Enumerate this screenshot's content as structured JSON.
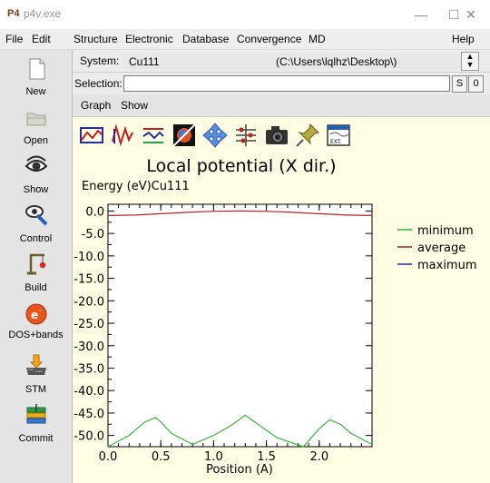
{
  "window": {
    "app_icon": "P4",
    "title": "p4v.exe",
    "buttons": {
      "minimize": "—",
      "maximize": "☐",
      "close": "✕"
    }
  },
  "menubar": {
    "items": [
      "File",
      "Edit",
      "Structure",
      "Electronic",
      "Database",
      "Convergence",
      "MD"
    ],
    "help": "Help"
  },
  "sidebar": {
    "items": [
      {
        "label": "New",
        "icon": "new-document-icon"
      },
      {
        "label": "Open",
        "icon": "open-folder-icon"
      },
      {
        "label": "Show",
        "icon": "eye-icon"
      },
      {
        "label": "Control",
        "icon": "control-wrench-icon"
      },
      {
        "label": "Build",
        "icon": "build-crane-icon"
      },
      {
        "label": "DOS+bands",
        "icon": "electron-icon"
      },
      {
        "label": "STM",
        "icon": "stm-icon"
      },
      {
        "label": "Commit",
        "icon": "commit-stack-icon"
      }
    ]
  },
  "system": {
    "label": "System:",
    "value": "Cu111",
    "path": "(C:\\Users\\lqlhz\\Desktop\\)"
  },
  "selection": {
    "label": "Selection:",
    "value": "",
    "btn_s": "S",
    "btn_0": "0"
  },
  "tabs": [
    "Graph",
    "Show"
  ],
  "toolbar": {
    "icons": [
      "chart-minmax-icon",
      "chart-wave-icon",
      "chart-avg-icon",
      "color-map-icon",
      "move-icon",
      "axes-icon",
      "camera-icon",
      "pin-icon",
      "export-icon"
    ],
    "export_label": "EXT."
  },
  "colors": {
    "minimum": "#3cb43c",
    "average": "#b02424",
    "maximum": "#2a2aa0",
    "plot_bg": "#ffffff",
    "panel_bg": "#fefce3"
  },
  "chart_data": {
    "type": "line",
    "title": "Local potential (X dir.)",
    "subtitle": "Energy (eV)Cu111",
    "xlabel": "Position (A)",
    "ylabel": "",
    "xlim": [
      0.0,
      2.5
    ],
    "ylim": [
      -52.5,
      1.5
    ],
    "xticks": [
      "0.0",
      "0.5",
      "1.0",
      "1.5",
      "2.0"
    ],
    "xtick_values": [
      0.0,
      0.5,
      1.0,
      1.5,
      2.0
    ],
    "yticks": [
      "0.0",
      "-5.0",
      "-10.0",
      "-15.0",
      "-20.0",
      "-25.0",
      "-30.0",
      "-35.0",
      "-40.0",
      "-45.0",
      "-50.0"
    ],
    "ytick_values": [
      0,
      -5,
      -10,
      -15,
      -20,
      -25,
      -30,
      -35,
      -40,
      -45,
      -50
    ],
    "legend_position": "right",
    "series": [
      {
        "name": "minimum",
        "x": [
          0.0,
          0.2,
          0.35,
          0.45,
          0.5,
          0.6,
          0.8,
          1.0,
          1.15,
          1.3,
          1.45,
          1.6,
          1.85,
          2.0,
          2.1,
          2.2,
          2.3,
          2.5
        ],
        "y": [
          -52.5,
          -50.0,
          -47.0,
          -46.0,
          -47.0,
          -49.5,
          -52.0,
          -50.0,
          -48.0,
          -45.5,
          -48.0,
          -50.5,
          -52.5,
          -48.5,
          -46.5,
          -47.5,
          -49.5,
          -52.0
        ]
      },
      {
        "name": "average",
        "x": [
          0.0,
          0.25,
          0.5,
          0.75,
          1.0,
          1.25,
          1.5,
          1.75,
          2.0,
          2.25,
          2.5
        ],
        "y": [
          -1.0,
          -0.9,
          -0.6,
          -0.3,
          -0.05,
          0.0,
          -0.05,
          -0.3,
          -0.6,
          -0.9,
          -1.0
        ]
      },
      {
        "name": "maximum",
        "x": [],
        "y": []
      }
    ]
  }
}
